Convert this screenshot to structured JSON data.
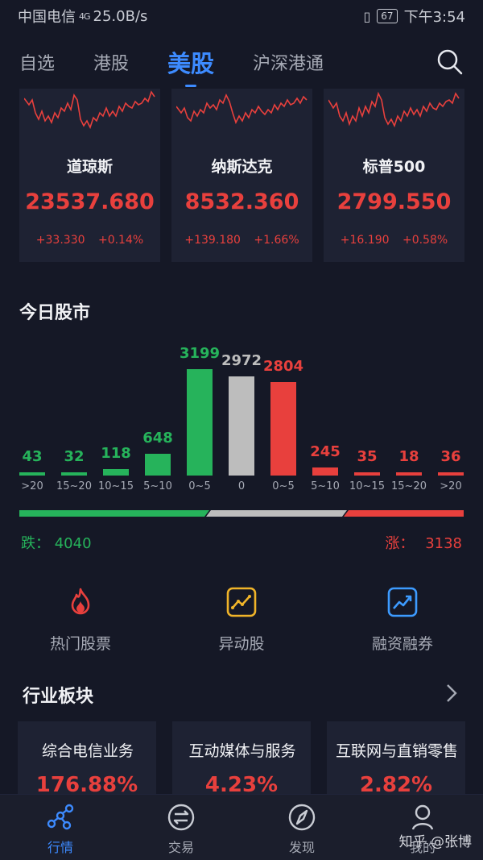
{
  "status_bar": {
    "carrier": "中国电信",
    "network": "4G",
    "speed": "25.0B/s",
    "battery": "67",
    "time": "下午3:54"
  },
  "tabs": [
    {
      "label": "自选",
      "active": false
    },
    {
      "label": "港股",
      "active": false
    },
    {
      "label": "美股",
      "active": true
    },
    {
      "label": "沪深港通",
      "active": false
    }
  ],
  "indices": [
    {
      "name": "道琼斯",
      "value": "23537.680",
      "change": "+33.330",
      "percent": "+0.14%"
    },
    {
      "name": "纳斯达克",
      "value": "8532.360",
      "change": "+139.180",
      "percent": "+1.66%"
    },
    {
      "name": "标普500",
      "value": "2799.550",
      "change": "+16.190",
      "percent": "+0.58%"
    }
  ],
  "market": {
    "title": "今日股市",
    "fall_label": "跌：",
    "fall_count": "4040",
    "rise_label": "涨：",
    "rise_count": "3138",
    "split_fractions": {
      "fall": 0.42,
      "flat": 0.31,
      "rise": 0.27
    }
  },
  "chart_data": {
    "type": "bar",
    "title": "今日股市",
    "categories": [
      ">20",
      "15~20",
      "10~15",
      "5~10",
      "0~5",
      "0",
      "0~5",
      "5~10",
      "10~15",
      "15~20",
      ">20"
    ],
    "values": [
      43,
      32,
      118,
      648,
      3199,
      2972,
      2804,
      245,
      35,
      18,
      36
    ],
    "bar_colors": [
      "green",
      "green",
      "green",
      "green",
      "green",
      "gray",
      "red",
      "red",
      "red",
      "red",
      "red"
    ],
    "colors": {
      "green": "#26b35b",
      "gray": "#bdbdbd",
      "red": "#e8403d"
    }
  },
  "shortcuts": [
    {
      "label": "热门股票",
      "icon": "fire-icon"
    },
    {
      "label": "异动股",
      "icon": "trend-chart-icon"
    },
    {
      "label": "融资融券",
      "icon": "margin-chart-icon"
    }
  ],
  "sectors": {
    "title": "行业板块",
    "items": [
      {
        "name": "综合电信业务",
        "percent": "176.88%"
      },
      {
        "name": "互动媒体与服务",
        "percent": "4.23%"
      },
      {
        "name": "互联网与直销零售",
        "percent": "2.82%"
      }
    ]
  },
  "bottom_nav": [
    {
      "label": "行情",
      "icon": "market-icon",
      "active": true
    },
    {
      "label": "交易",
      "icon": "trade-icon",
      "active": false
    },
    {
      "label": "发现",
      "icon": "compass-icon",
      "active": false
    },
    {
      "label": "我的",
      "icon": "profile-icon",
      "active": false
    }
  ],
  "watermark": "知乎 @张博",
  "colors": {
    "background": "#151826",
    "card": "#1e2233",
    "accent": "#3d8bff",
    "up": "#e8403d",
    "down": "#26b35b"
  }
}
